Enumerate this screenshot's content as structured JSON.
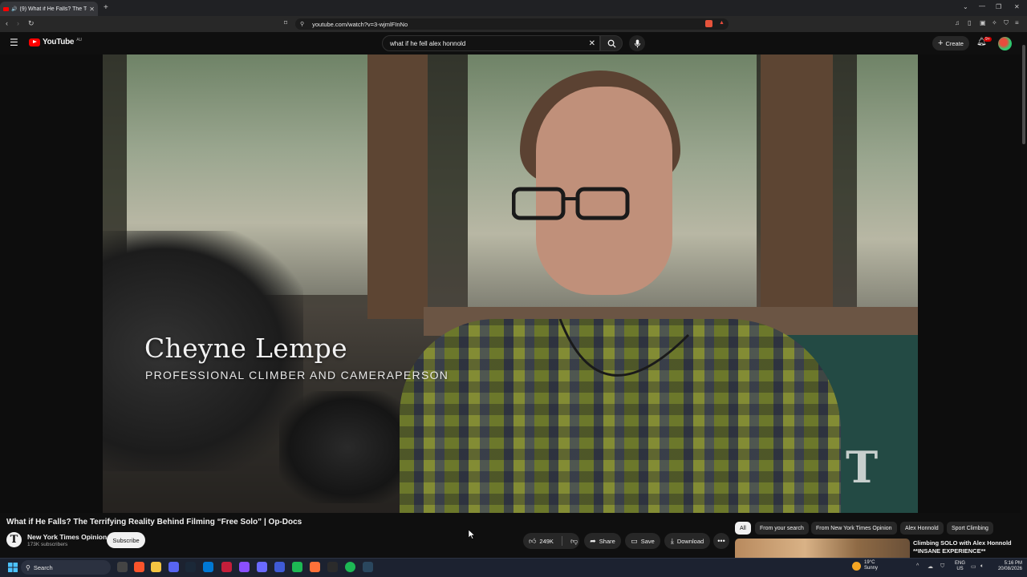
{
  "browser": {
    "tab_title": "(9) What if He Falls? The Terri",
    "new_tab_label": "+",
    "url": "youtube.com/watch?v=3-wjmlFInNo",
    "window_controls": [
      "minimize",
      "maximize",
      "close"
    ]
  },
  "youtube": {
    "logo_text": "YouTube",
    "region": "AU",
    "search_query": "what if he fell alex honnold",
    "create_label": "Create",
    "notification_count": "9+"
  },
  "video": {
    "lower_third_name": "Cheyne Lempe",
    "lower_third_title": "PROFESSIONAL CLIMBER AND CAMERAPERSON",
    "watermark": "T",
    "title": "What if He Falls? The Terrifying Reality Behind Filming “Free Solo” | Op-Docs",
    "channel_name": "New York Times Opinion",
    "channel_initial": "T",
    "subscribers": "173K subscribers",
    "subscribe_label": "Subscribe",
    "likes": "249K",
    "share_label": "Share",
    "save_label": "Save",
    "download_label": "Download"
  },
  "filter_chips": [
    {
      "label": "All",
      "selected": true
    },
    {
      "label": "From your search",
      "selected": false
    },
    {
      "label": "From New York Times Opinion",
      "selected": false
    },
    {
      "label": "Alex Honnold",
      "selected": false
    },
    {
      "label": "Sport Climbing",
      "selected": false
    }
  ],
  "recommendation": {
    "title": "Climbing SOLO with Alex Honnold **INSANE EXPERIENCE**"
  },
  "taskbar": {
    "search_label": "Search",
    "temperature": "19°C",
    "weather": "Sunny",
    "lang_line1": "ENG",
    "lang_line2": "US",
    "time": "5:16 PM",
    "date": "20/08/2026"
  },
  "colors": {
    "youtube_red": "#ff0000",
    "background": "#0f0f0f",
    "pill": "#272727"
  }
}
